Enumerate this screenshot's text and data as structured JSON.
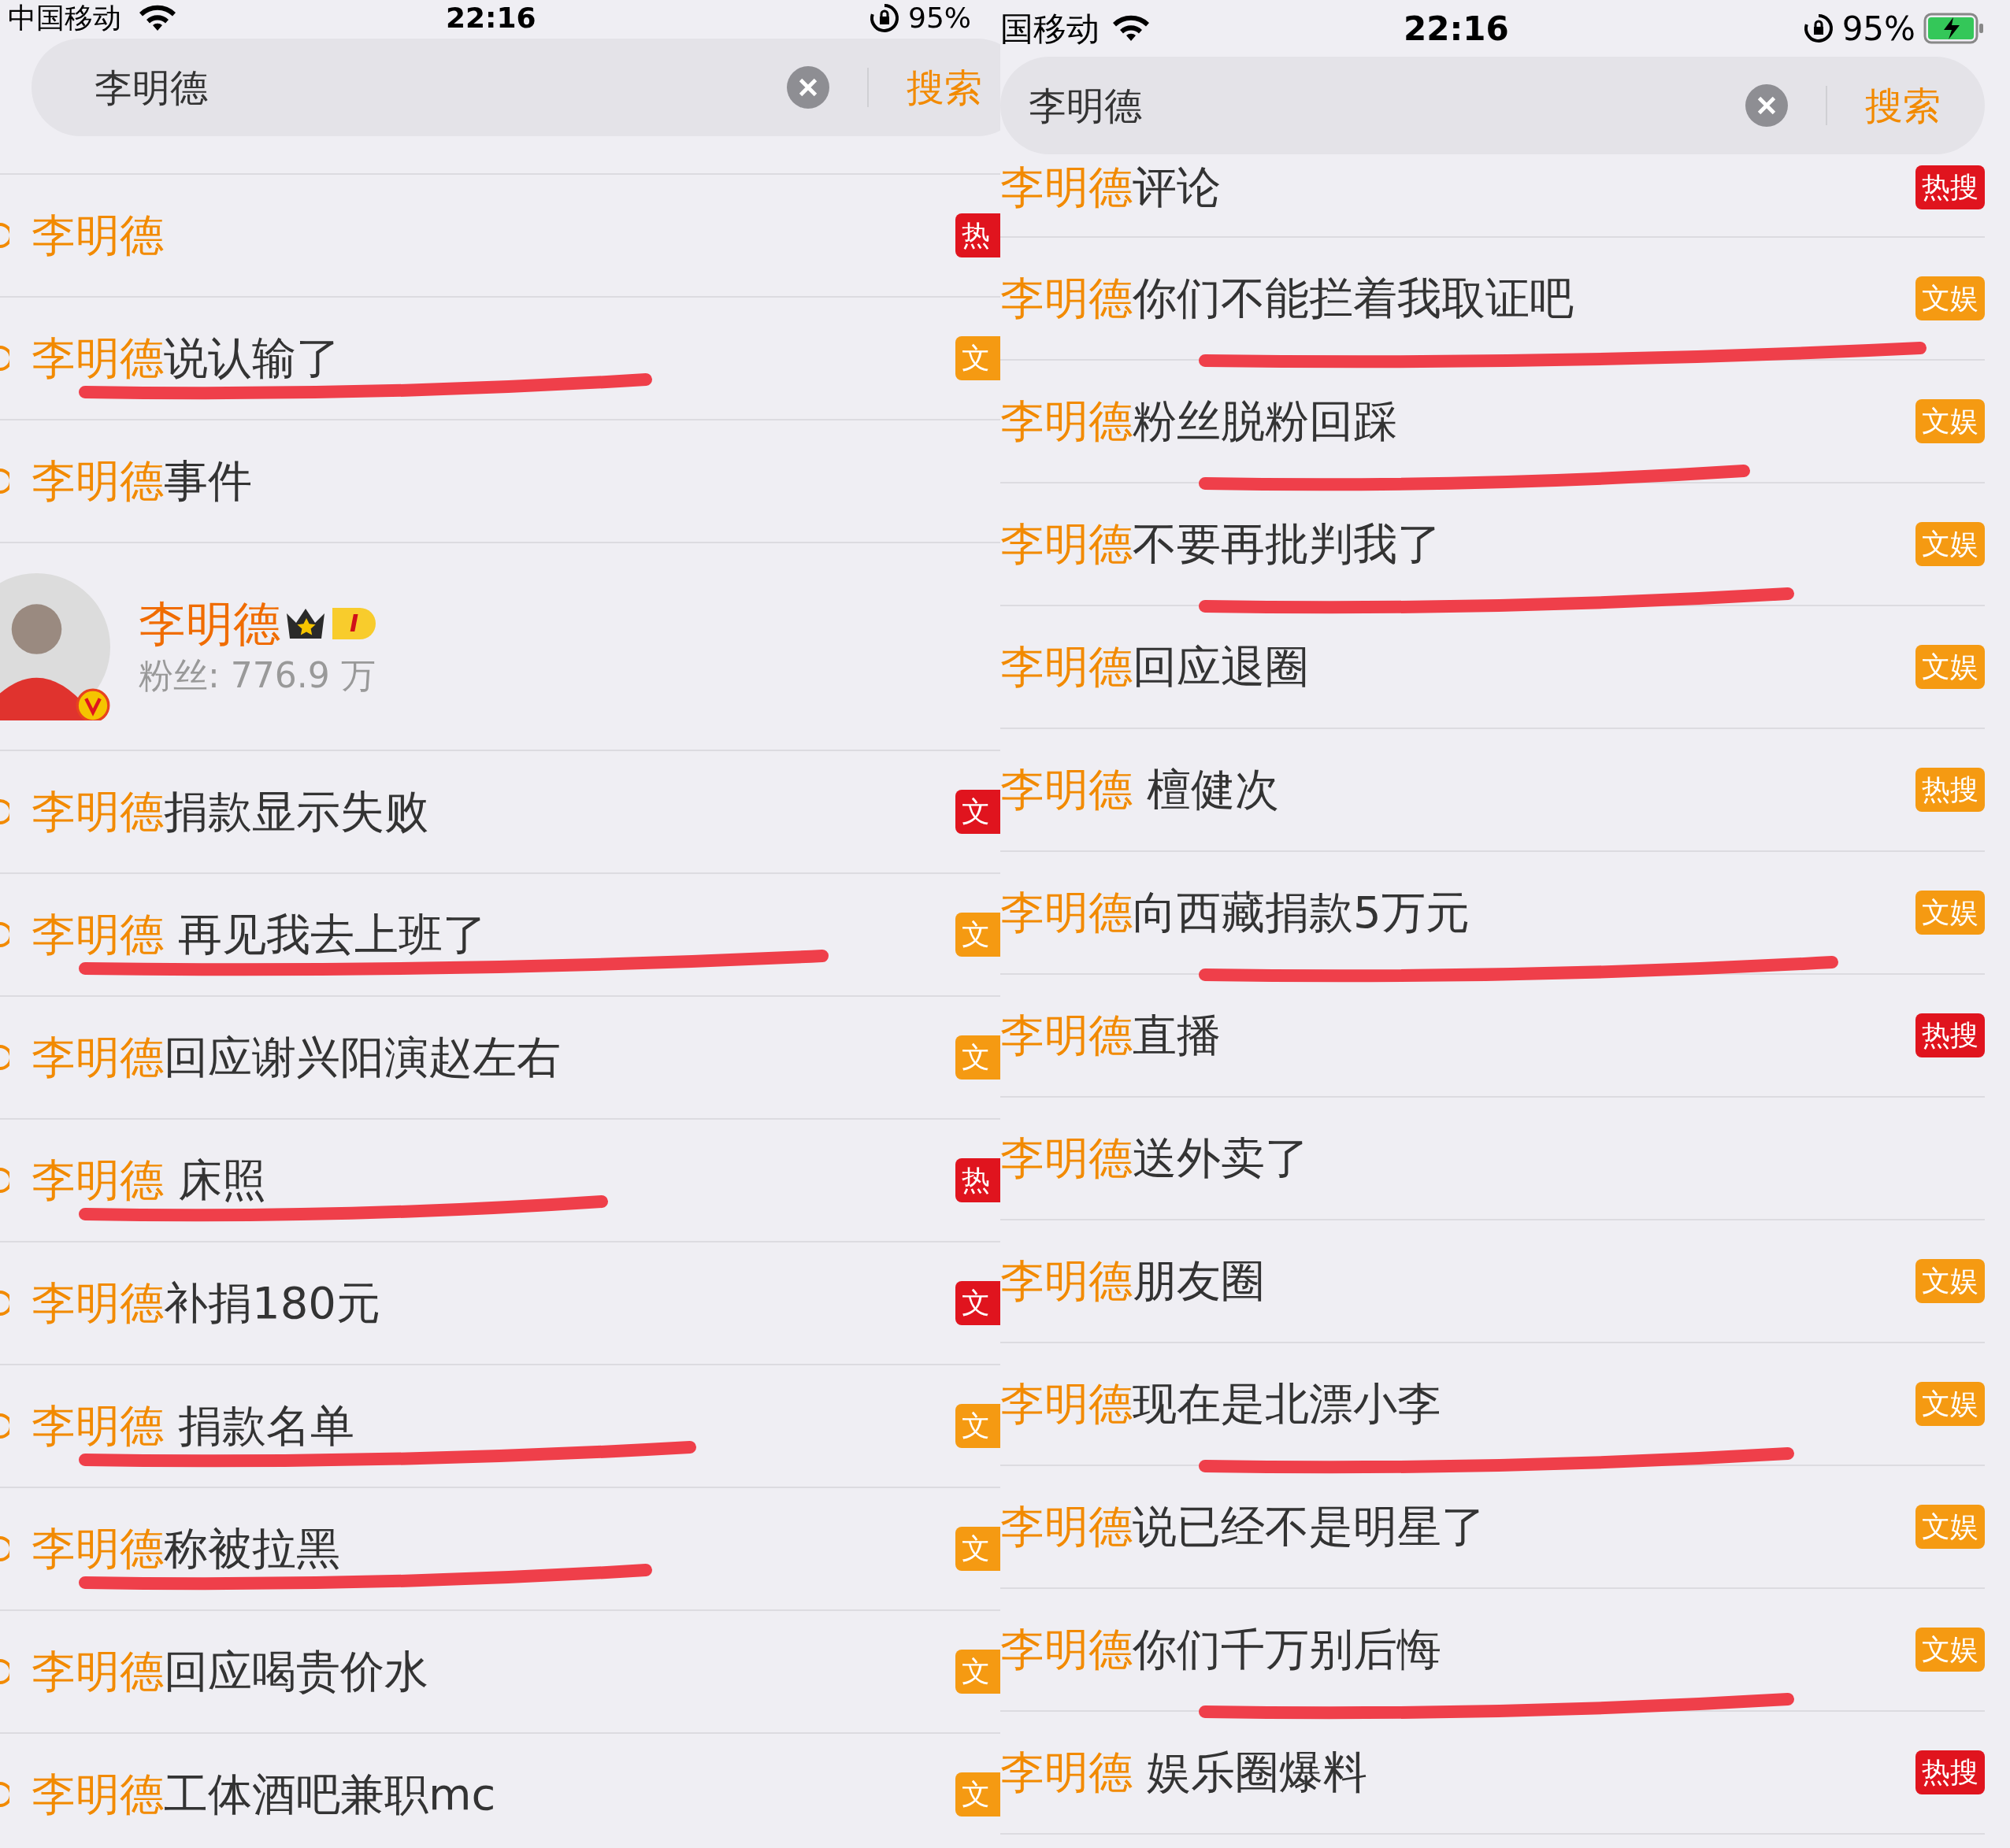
{
  "left": {
    "status_bar": {
      "carrier": "中国移动",
      "time": "22:16",
      "battery": "95%"
    },
    "search": {
      "value": "李明德",
      "button": "搜索"
    },
    "rows": [
      {
        "kind": "suggestion",
        "keyword": "李明德",
        "rest": "",
        "underlined": false,
        "badge": {
          "text": "热",
          "color": "#e0141e"
        }
      },
      {
        "kind": "suggestion",
        "keyword": "李明德",
        "rest": "说认输了",
        "underlined": true,
        "badge": {
          "text": "文",
          "color": "#f59a12"
        }
      },
      {
        "kind": "suggestion",
        "keyword": "李明德",
        "rest": "事件",
        "underlined": false
      },
      {
        "kind": "user",
        "name": "李明德",
        "level": "I",
        "fans": "粉丝: 776.9 万"
      },
      {
        "kind": "suggestion",
        "keyword": "李明德",
        "rest": "捐款显示失败",
        "underlined": false,
        "badge": {
          "text": "文",
          "color": "#e0141e"
        }
      },
      {
        "kind": "suggestion",
        "keyword": "李明德",
        "rest": " 再见我去上班了",
        "underlined": true,
        "badge": {
          "text": "文",
          "color": "#f59a12"
        }
      },
      {
        "kind": "suggestion",
        "keyword": "李明德",
        "rest": "回应谢兴阳演赵左右",
        "underlined": false,
        "badge": {
          "text": "文",
          "color": "#f59a12"
        }
      },
      {
        "kind": "suggestion",
        "keyword": "李明德",
        "rest": " 床照",
        "underlined": true,
        "badge": {
          "text": "热",
          "color": "#e0141e"
        }
      },
      {
        "kind": "suggestion",
        "keyword": "李明德",
        "rest": "补捐180元",
        "underlined": false,
        "badge": {
          "text": "文",
          "color": "#e0141e"
        }
      },
      {
        "kind": "suggestion",
        "keyword": "李明德",
        "rest": " 捐款名单",
        "underlined": true,
        "badge": {
          "text": "文",
          "color": "#f59a12"
        }
      },
      {
        "kind": "suggestion",
        "keyword": "李明德",
        "rest": "称被拉黑",
        "underlined": true,
        "badge": {
          "text": "文",
          "color": "#f59a12"
        }
      },
      {
        "kind": "suggestion",
        "keyword": "李明德",
        "rest": "回应喝贵价水",
        "underlined": false,
        "badge": {
          "text": "文",
          "color": "#f59a12"
        }
      },
      {
        "kind": "suggestion",
        "keyword": "李明德",
        "rest": "工体酒吧兼职mc",
        "underlined": false,
        "badge": {
          "text": "文",
          "color": "#f59a12"
        }
      }
    ]
  },
  "right": {
    "status_bar": {
      "carrier": "国移动",
      "time": "22:16",
      "battery": "95%"
    },
    "search": {
      "value": "李明德",
      "button": "搜索"
    },
    "rows": [
      {
        "keyword": "李明德",
        "rest": "评论",
        "underlined": false,
        "badge": {
          "text": "热搜",
          "color": "#e0141e"
        }
      },
      {
        "keyword": "李明德",
        "rest": "你们不能拦着我取证吧",
        "underlined": true,
        "badge": {
          "text": "文娱",
          "color": "#f59a12"
        }
      },
      {
        "keyword": "李明德",
        "rest": "粉丝脱粉回踩",
        "underlined": true,
        "badge": {
          "text": "文娱",
          "color": "#f59a12"
        }
      },
      {
        "keyword": "李明德",
        "rest": "不要再批判我了",
        "underlined": true,
        "badge": {
          "text": "文娱",
          "color": "#f59a12"
        }
      },
      {
        "keyword": "李明德",
        "rest": "回应退圈",
        "underlined": false,
        "badge": {
          "text": "文娱",
          "color": "#f59a12"
        }
      },
      {
        "keyword": "李明德",
        "rest": " 檀健次",
        "underlined": false,
        "badge": {
          "text": "热搜",
          "color": "#f59a12"
        }
      },
      {
        "keyword": "李明德",
        "rest": "向西藏捐款5万元",
        "underlined": true,
        "badge": {
          "text": "文娱",
          "color": "#f59a12"
        }
      },
      {
        "keyword": "李明德",
        "rest": "直播",
        "underlined": false,
        "badge": {
          "text": "热搜",
          "color": "#e0141e"
        }
      },
      {
        "keyword": "李明德",
        "rest": "送外卖了",
        "underlined": false
      },
      {
        "keyword": "李明德",
        "rest": "朋友圈",
        "underlined": false,
        "badge": {
          "text": "文娱",
          "color": "#f59a12"
        }
      },
      {
        "keyword": "李明德",
        "rest": "现在是北漂小李",
        "underlined": true,
        "badge": {
          "text": "文娱",
          "color": "#f59a12"
        }
      },
      {
        "keyword": "李明德",
        "rest": "说已经不是明星了",
        "underlined": false,
        "badge": {
          "text": "文娱",
          "color": "#f59a12"
        }
      },
      {
        "keyword": "李明德",
        "rest": "你们千万别后悔",
        "underlined": true,
        "badge": {
          "text": "文娱",
          "color": "#f59a12"
        }
      },
      {
        "keyword": "李明德",
        "rest": " 娱乐圈爆料",
        "underlined": false,
        "badge": {
          "text": "热搜",
          "color": "#e0141e"
        }
      }
    ]
  }
}
